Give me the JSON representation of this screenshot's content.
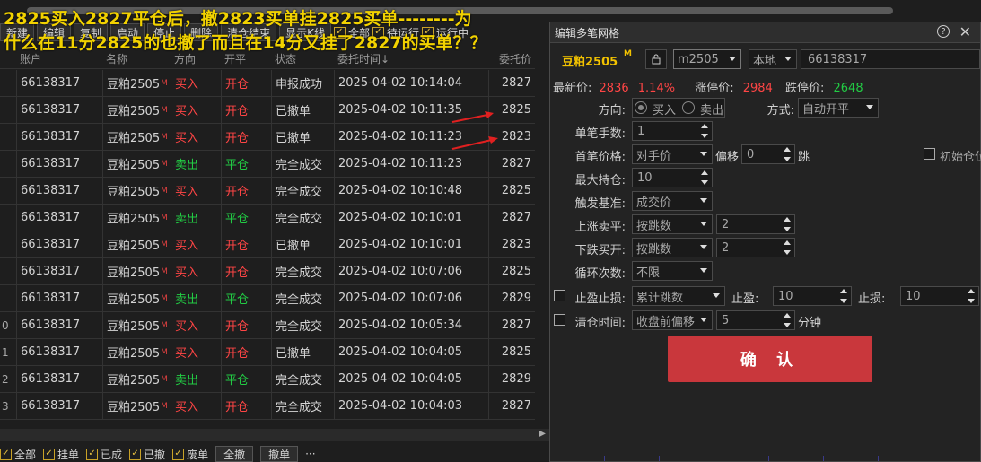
{
  "toolbar": {
    "buttons": [
      "新建",
      "编辑",
      "复制",
      "启动",
      "停止",
      "删除",
      "清仓结束",
      "显示K线"
    ],
    "checks": [
      "全部",
      "待运行",
      "运行中"
    ]
  },
  "table": {
    "headers": [
      "账户",
      "名称",
      "方向",
      "开平",
      "状态",
      "委托时间↓",
      "委托价"
    ],
    "rows": [
      {
        "idx": "",
        "acct": "66138317",
        "name": "豆粕2505",
        "mark": "M",
        "dir": "买入",
        "oc": "开仓",
        "status": "申报成功",
        "time": "2025-04-02 10:14:04",
        "price": "2827"
      },
      {
        "idx": "",
        "acct": "66138317",
        "name": "豆粕2505",
        "mark": "M",
        "dir": "买入",
        "oc": "开仓",
        "status": "已撤单",
        "time": "2025-04-02 10:11:35",
        "price": "2825"
      },
      {
        "idx": "",
        "acct": "66138317",
        "name": "豆粕2505",
        "mark": "M",
        "dir": "买入",
        "oc": "开仓",
        "status": "已撤单",
        "time": "2025-04-02 10:11:23",
        "price": "2823"
      },
      {
        "idx": "",
        "acct": "66138317",
        "name": "豆粕2505",
        "mark": "M",
        "dir": "卖出",
        "oc": "平仓",
        "status": "完全成交",
        "time": "2025-04-02 10:11:23",
        "price": "2827"
      },
      {
        "idx": "",
        "acct": "66138317",
        "name": "豆粕2505",
        "mark": "M",
        "dir": "买入",
        "oc": "开仓",
        "status": "完全成交",
        "time": "2025-04-02 10:10:48",
        "price": "2825"
      },
      {
        "idx": "",
        "acct": "66138317",
        "name": "豆粕2505",
        "mark": "M",
        "dir": "卖出",
        "oc": "平仓",
        "status": "完全成交",
        "time": "2025-04-02 10:10:01",
        "price": "2827"
      },
      {
        "idx": "",
        "acct": "66138317",
        "name": "豆粕2505",
        "mark": "M",
        "dir": "买入",
        "oc": "开仓",
        "status": "已撤单",
        "time": "2025-04-02 10:10:01",
        "price": "2823"
      },
      {
        "idx": "",
        "acct": "66138317",
        "name": "豆粕2505",
        "mark": "M",
        "dir": "买入",
        "oc": "开仓",
        "status": "完全成交",
        "time": "2025-04-02 10:07:06",
        "price": "2825"
      },
      {
        "idx": "",
        "acct": "66138317",
        "name": "豆粕2505",
        "mark": "M",
        "dir": "卖出",
        "oc": "平仓",
        "status": "完全成交",
        "time": "2025-04-02 10:07:06",
        "price": "2829"
      },
      {
        "idx": "0",
        "acct": "66138317",
        "name": "豆粕2505",
        "mark": "M",
        "dir": "买入",
        "oc": "开仓",
        "status": "完全成交",
        "time": "2025-04-02 10:05:34",
        "price": "2827"
      },
      {
        "idx": "1",
        "acct": "66138317",
        "name": "豆粕2505",
        "mark": "M",
        "dir": "买入",
        "oc": "开仓",
        "status": "已撤单",
        "time": "2025-04-02 10:04:05",
        "price": "2825"
      },
      {
        "idx": "2",
        "acct": "66138317",
        "name": "豆粕2505",
        "mark": "M",
        "dir": "卖出",
        "oc": "平仓",
        "status": "完全成交",
        "time": "2025-04-02 10:04:05",
        "price": "2829"
      },
      {
        "idx": "3",
        "acct": "66138317",
        "name": "豆粕2505",
        "mark": "M",
        "dir": "买入",
        "oc": "开仓",
        "status": "完全成交",
        "time": "2025-04-02 10:04:03",
        "price": "2827"
      }
    ]
  },
  "bottombar": {
    "checks": [
      "全部",
      "挂单",
      "已成",
      "已撤",
      "废单"
    ],
    "buttons": [
      "全撤",
      "撤单"
    ],
    "more": "···"
  },
  "annotation": "2825买入2827平仓后，撤2823买单挂2825买单--------为什么在11分2825的也撤了而且在14分又挂了2827的买单？？",
  "dialog": {
    "title": "编辑多笔网格",
    "help": "?",
    "close": "✕",
    "symbol": "豆粕2505",
    "symbol_mark": "M",
    "code": "m2505",
    "mode": "本地",
    "account": "66138317",
    "latest_label": "最新价:",
    "latest": "2836",
    "change": "1.14%",
    "limit_up_label": "涨停价:",
    "limit_up": "2984",
    "limit_down_label": "跌停价:",
    "limit_down": "2648",
    "direction_label": "方向:",
    "buy": "买入",
    "sell": "卖出",
    "method_label": "方式:",
    "method": "自动开平",
    "qty_label": "单笔手数:",
    "qty": "1",
    "first_price_label": "首笔价格:",
    "first_price": "对手价",
    "offset_label": "偏移",
    "offset": "0",
    "tick_label": "跳",
    "init_pos_label": "初始仓位",
    "max_pos_label": "最大持仓:",
    "max_pos": "10",
    "trigger_label": "触发基准:",
    "trigger": "成交价",
    "rise_label": "上涨卖平:",
    "rise_mode": "按跳数",
    "rise_val": "2",
    "fall_label": "下跌买开:",
    "fall_mode": "按跳数",
    "fall_val": "2",
    "loop_label": "循环次数:",
    "loop": "不限",
    "tpsl_label": "止盈止损:",
    "tpsl_mode": "累计跳数",
    "tp_label": "止盈:",
    "tp": "10",
    "sl_label": "止损:",
    "sl": "10",
    "clear_label": "清仓时间:",
    "clear_mode": "收盘前偏移",
    "clear_val": "5",
    "minute_label": "分钟",
    "confirm": "确 认"
  }
}
